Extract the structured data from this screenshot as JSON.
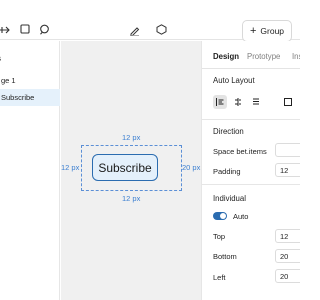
{
  "toolbar": {
    "add_group_label": "Group",
    "add_group_icon": "plus-icon"
  },
  "sidebar": {
    "heading": "s",
    "items": [
      {
        "label": "ge 1",
        "active": false
      },
      {
        "label": "Subscribe",
        "active": true
      }
    ]
  },
  "canvas": {
    "button_label": "Subscribe",
    "padding_top": "12 px",
    "padding_bottom": "12 px",
    "padding_left": "12 px",
    "padding_right": "20 px"
  },
  "panel": {
    "tabs": [
      {
        "label": "Design",
        "active": true
      },
      {
        "label": "Prototype",
        "active": false
      },
      {
        "label": "Ins",
        "active": false
      }
    ],
    "auto_layout_title": "Auto Layout",
    "direction_title": "Direction",
    "space_between_label": "Space bet.items",
    "padding_label": "Padding",
    "padding_value": "12",
    "individual_title": "Individual",
    "auto_label": "Auto",
    "auto_enabled": true,
    "top_label": "Top",
    "top_value": "12",
    "bottom_label": "Bottom",
    "bottom_value": "20",
    "left_label": "Left",
    "left_value": "20"
  },
  "colors": {
    "accent": "#2b6cb0",
    "selection": "#e5f1fb",
    "measure_text": "#3b7fd1",
    "canvas_bg": "#f0f0f0"
  }
}
